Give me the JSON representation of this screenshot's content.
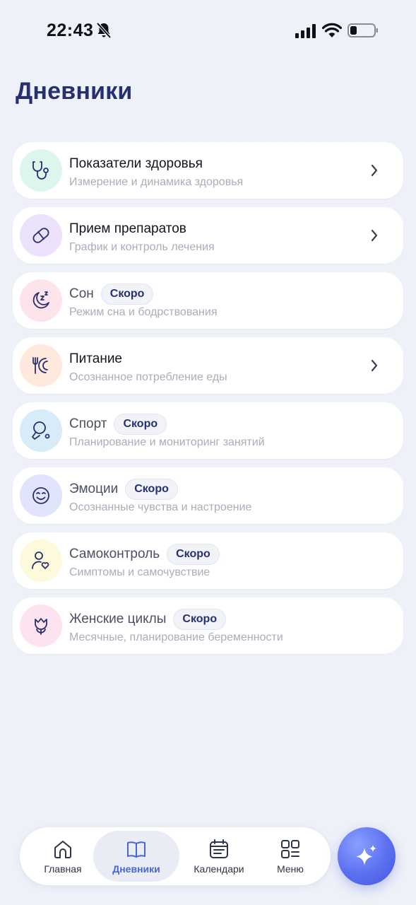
{
  "status_bar": {
    "time": "22:43",
    "icons": [
      "bell-slash-icon",
      "signal-icon",
      "wifi-icon",
      "battery-icon"
    ]
  },
  "page": {
    "title": "Дневники"
  },
  "cards": [
    {
      "title": "Показатели здоровья",
      "subtitle": "Измерение и динамика здоровья",
      "icon": "stethoscope-icon",
      "icon_bg": "#dcf6ee",
      "badge": "",
      "chevron": true
    },
    {
      "title": "Прием препаратов",
      "subtitle": "График и контроль лечения",
      "icon": "pill-icon",
      "icon_bg": "#ece2fb",
      "badge": "",
      "chevron": true
    },
    {
      "title": "Сон",
      "subtitle": "Режим сна и бодрствования",
      "icon": "moon-zzz-icon",
      "icon_bg": "#fde4ea",
      "badge": "Скоро",
      "chevron": false
    },
    {
      "title": "Питание",
      "subtitle": "Осознанное потребление еды",
      "icon": "fork-plate-icon",
      "icon_bg": "#fee9dc",
      "badge": "",
      "chevron": true
    },
    {
      "title": "Спорт",
      "subtitle": "Планирование и мониторинг занятий",
      "icon": "ping-pong-icon",
      "icon_bg": "#d7ebf8",
      "badge": "Скоро",
      "chevron": false
    },
    {
      "title": "Эмоции",
      "subtitle": "Осознанные чувства и настроение",
      "icon": "smile-icon",
      "icon_bg": "#e1e4fb",
      "badge": "Скоро",
      "chevron": false
    },
    {
      "title": "Самоконтроль",
      "subtitle": "Симптомы и самочувствие",
      "icon": "person-heart-icon",
      "icon_bg": "#fdfadc",
      "badge": "Скоро",
      "chevron": false
    },
    {
      "title": "Женские циклы",
      "subtitle": "Месячные, планирование беременности",
      "icon": "tulip-icon",
      "icon_bg": "#fde2f0",
      "badge": "Скоро",
      "chevron": false
    }
  ],
  "bottom_nav": {
    "items": [
      {
        "label": "Главная",
        "icon": "home-icon",
        "active": false
      },
      {
        "label": "Дневники",
        "icon": "book-icon",
        "active": true
      },
      {
        "label": "Календари",
        "icon": "calendar-icon",
        "active": false
      },
      {
        "label": "Меню",
        "icon": "grid-menu-icon",
        "active": false
      }
    ]
  },
  "fab": {
    "icon": "sparkle-icon"
  },
  "colors": {
    "background": "#eef1f8",
    "title": "#27306f",
    "accent": "#4a63d9",
    "icon_stroke": "#2a2f6e"
  }
}
